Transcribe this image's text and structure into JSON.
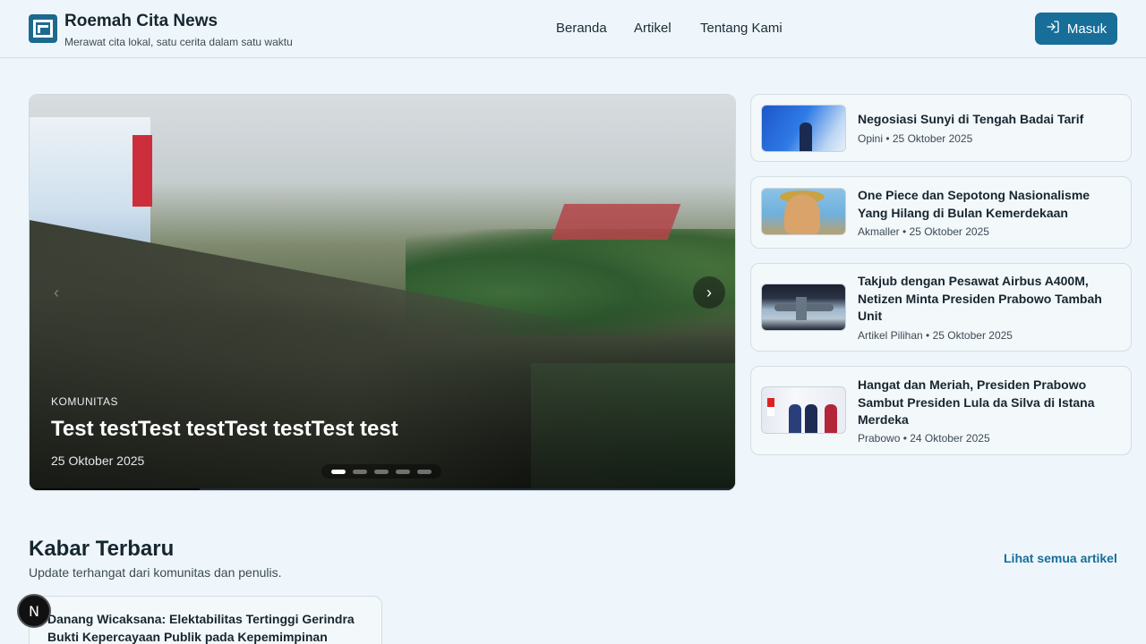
{
  "brand": {
    "title": "Roemah Cita News",
    "tagline": "Merawat cita lokal, satu cerita dalam satu waktu",
    "accent": "#176e99"
  },
  "nav": {
    "items": [
      {
        "label": "Beranda"
      },
      {
        "label": "Artikel"
      },
      {
        "label": "Tentang Kami"
      }
    ]
  },
  "auth": {
    "login_label": "Masuk",
    "login_icon": "login-icon"
  },
  "hero": {
    "category": "KOMUNITAS",
    "title": "Test testTest testTest testTest test",
    "date": "25 Oktober 2025",
    "prev_icon": "chevron-left-icon",
    "next_icon": "chevron-right-icon",
    "prev_glyph": "‹",
    "next_glyph": "›",
    "slide_count": 5,
    "active_slide": 1
  },
  "side_articles": [
    {
      "title": "Negosiasi Sunyi di Tengah Badai Tarif",
      "meta": "Opini • 25 Oktober 2025"
    },
    {
      "title": "One Piece dan Sepotong Nasionalisme Yang Hilang di Bulan Kemerdekaan",
      "meta": "Akmaller • 25 Oktober 2025"
    },
    {
      "title": "Takjub dengan Pesawat Airbus A400M, Netizen Minta Presiden Prabowo Tambah Unit",
      "meta": "Artikel Pilihan • 25 Oktober 2025"
    },
    {
      "title": "Hangat dan Meriah, Presiden Prabowo Sambut Presiden Lula da Silva di Istana Merdeka",
      "meta": "Prabowo • 24 Oktober 2025"
    }
  ],
  "latest": {
    "title": "Kabar Terbaru",
    "subtitle": "Update terhangat dari komunitas dan penulis.",
    "see_all": "Lihat semua artikel",
    "items": [
      {
        "title": "Danang Wicaksana: Elektabilitas Tertinggi Gerindra Bukti Kepercayaan Publik pada Kepemimpinan"
      }
    ]
  },
  "dev_badge": {
    "label": "N"
  }
}
